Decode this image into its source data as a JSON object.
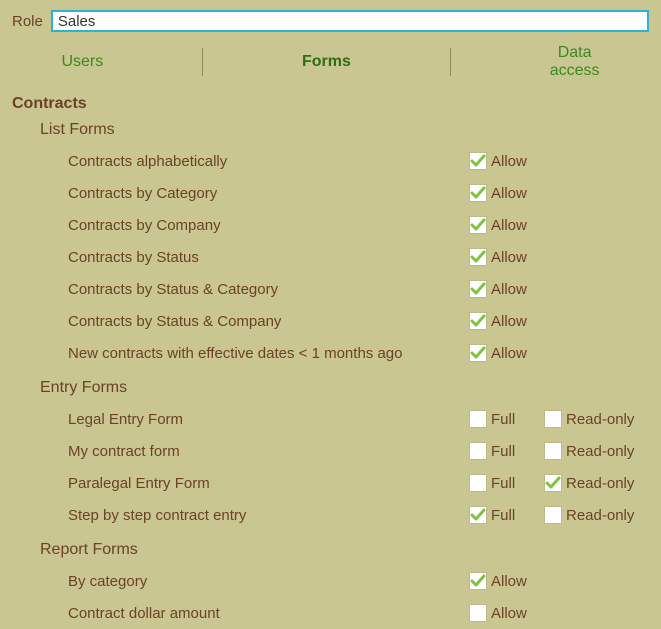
{
  "role": {
    "label": "Role",
    "value": "Sales"
  },
  "tabs": {
    "users": "Users",
    "forms": "Forms",
    "data_access": "Data\naccess"
  },
  "section": "Contracts",
  "labels": {
    "allow": "Allow",
    "full": "Full",
    "readonly": "Read-only"
  },
  "list_forms": {
    "title": "List Forms",
    "items": [
      {
        "label": "Contracts alphabetically",
        "allow": true
      },
      {
        "label": "Contracts by Category",
        "allow": true
      },
      {
        "label": "Contracts by Company",
        "allow": true
      },
      {
        "label": "Contracts by Status",
        "allow": true
      },
      {
        "label": "Contracts by Status & Category",
        "allow": true
      },
      {
        "label": "Contracts by Status & Company",
        "allow": true
      },
      {
        "label": "New contracts with effective dates < 1 months ago",
        "allow": true
      }
    ]
  },
  "entry_forms": {
    "title": "Entry Forms",
    "items": [
      {
        "label": "Legal Entry Form",
        "full": false,
        "readonly": false
      },
      {
        "label": "My contract form",
        "full": false,
        "readonly": false
      },
      {
        "label": "Paralegal Entry Form",
        "full": false,
        "readonly": true
      },
      {
        "label": "Step by step contract entry",
        "full": true,
        "readonly": false
      }
    ]
  },
  "report_forms": {
    "title": "Report Forms",
    "items": [
      {
        "label": "By category",
        "allow": true
      },
      {
        "label": "Contract dollar amount",
        "allow": false
      }
    ]
  }
}
